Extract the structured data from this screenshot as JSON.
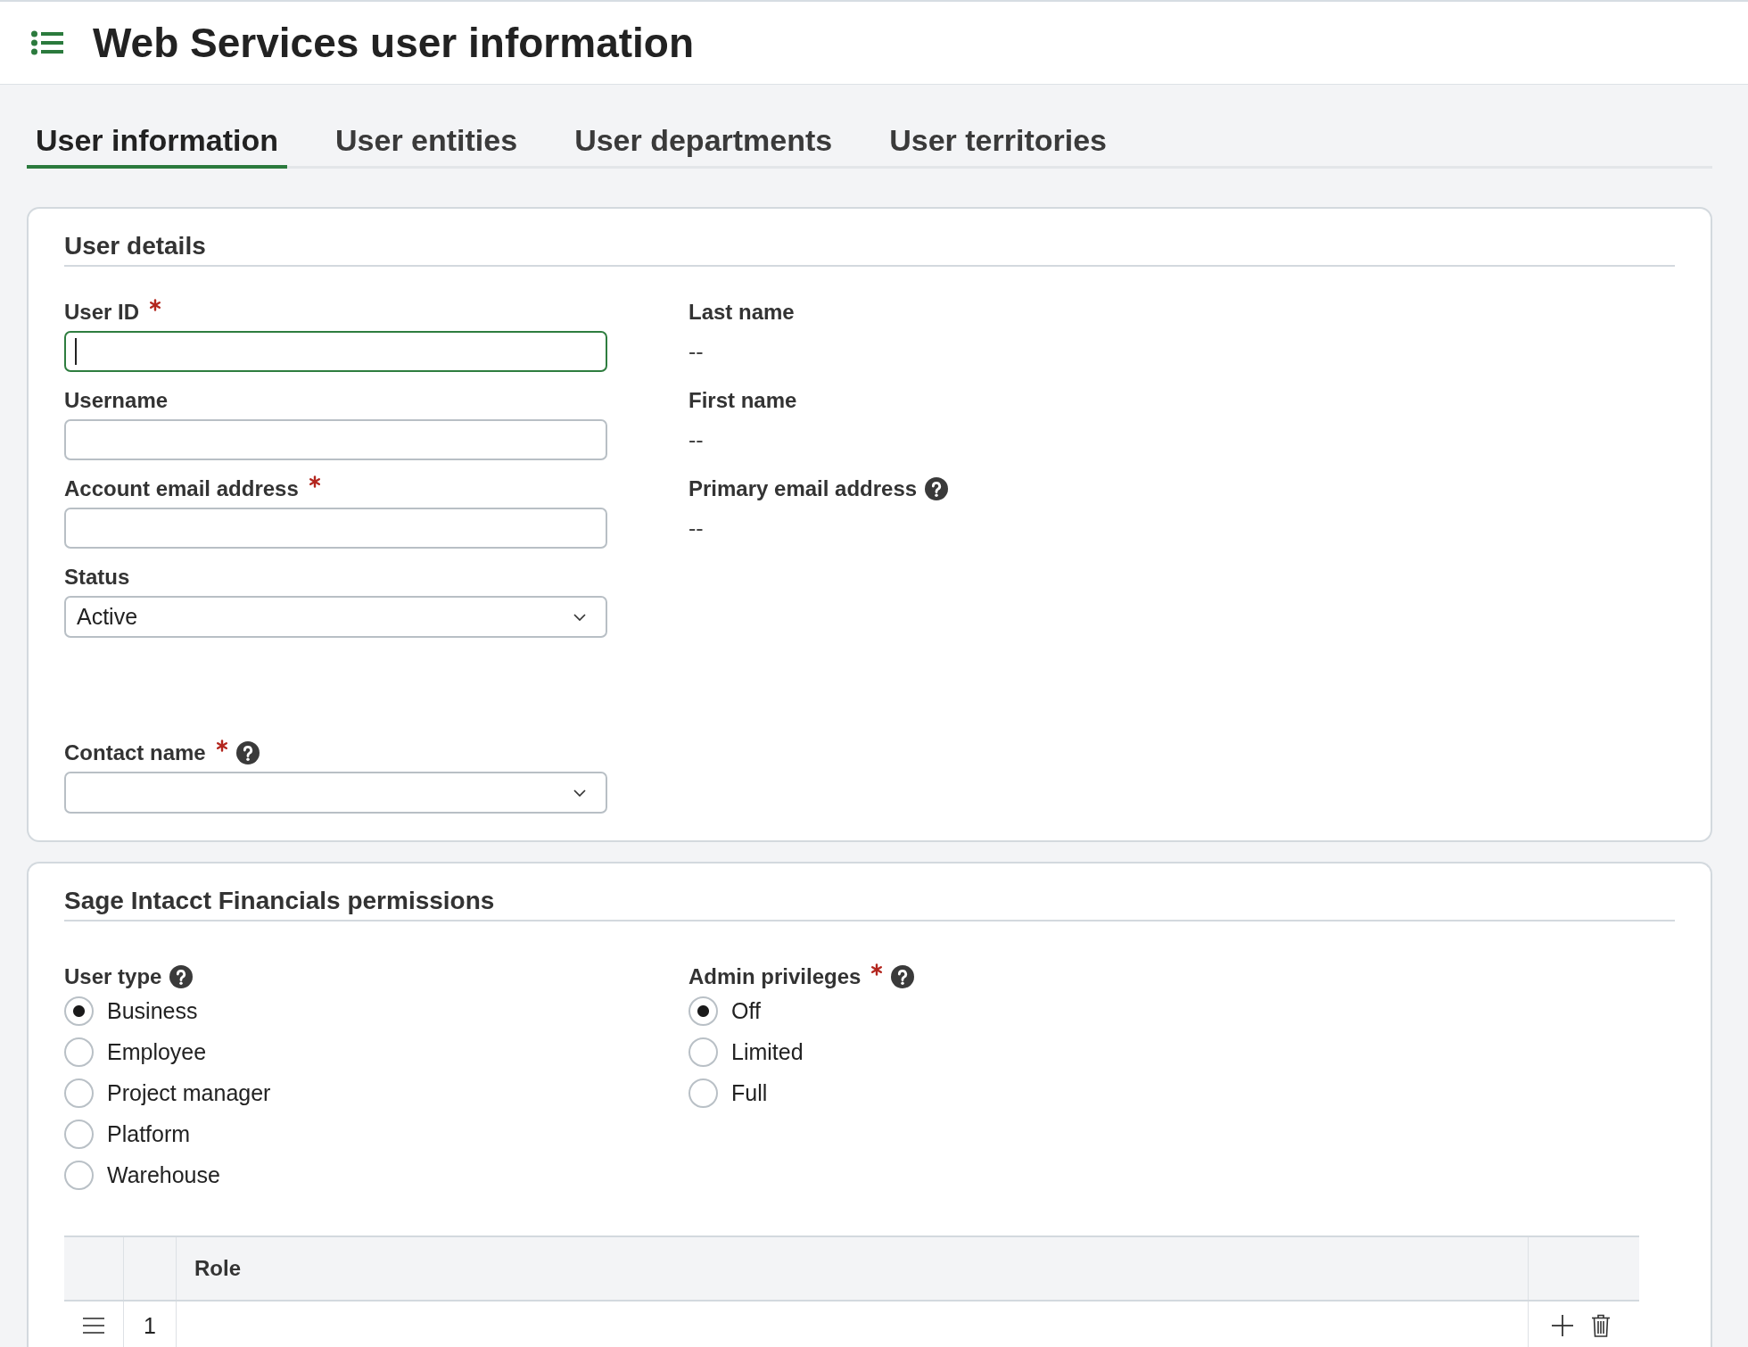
{
  "header": {
    "title": "Web Services user information"
  },
  "tabs": [
    {
      "label": "User information",
      "selected": true
    },
    {
      "label": "User entities",
      "selected": false
    },
    {
      "label": "User departments",
      "selected": false
    },
    {
      "label": "User territories",
      "selected": false
    }
  ],
  "user_details": {
    "title": "User details",
    "left_fields": [
      {
        "label": "User ID",
        "kind": "text",
        "required": true,
        "help": false,
        "focused": true
      },
      {
        "label": "Username",
        "kind": "text",
        "required": false,
        "help": false,
        "focused": false
      },
      {
        "label": "Account email address",
        "kind": "text",
        "required": true,
        "help": false,
        "focused": false
      },
      {
        "label": "Status",
        "kind": "select",
        "required": false,
        "help": false,
        "focused": false,
        "value": "Active"
      }
    ],
    "right_fields": [
      {
        "label": "Last name",
        "help": false,
        "value": "--"
      },
      {
        "label": "First name",
        "help": false,
        "value": "--"
      },
      {
        "label": "Primary email address",
        "help": true,
        "value": "--"
      }
    ],
    "contact_field": {
      "label": "Contact name",
      "kind": "select",
      "required": true,
      "help": true,
      "focused": false
    }
  },
  "permissions": {
    "title": "Sage Intacct Financials permissions",
    "groups": [
      {
        "label": "User type",
        "required": false,
        "help": true,
        "options": [
          {
            "label": "Business",
            "selected": true
          },
          {
            "label": "Employee",
            "selected": false
          },
          {
            "label": "Project manager",
            "selected": false
          },
          {
            "label": "Platform",
            "selected": false
          },
          {
            "label": "Warehouse",
            "selected": false
          }
        ]
      },
      {
        "label": "Admin privileges",
        "required": true,
        "help": true,
        "options": [
          {
            "label": "Off",
            "selected": true
          },
          {
            "label": "Limited",
            "selected": false
          },
          {
            "label": "Full",
            "selected": false
          }
        ]
      }
    ],
    "roles_table": {
      "columns": [
        "Role"
      ],
      "rows": [
        {
          "number": "1"
        }
      ]
    }
  }
}
